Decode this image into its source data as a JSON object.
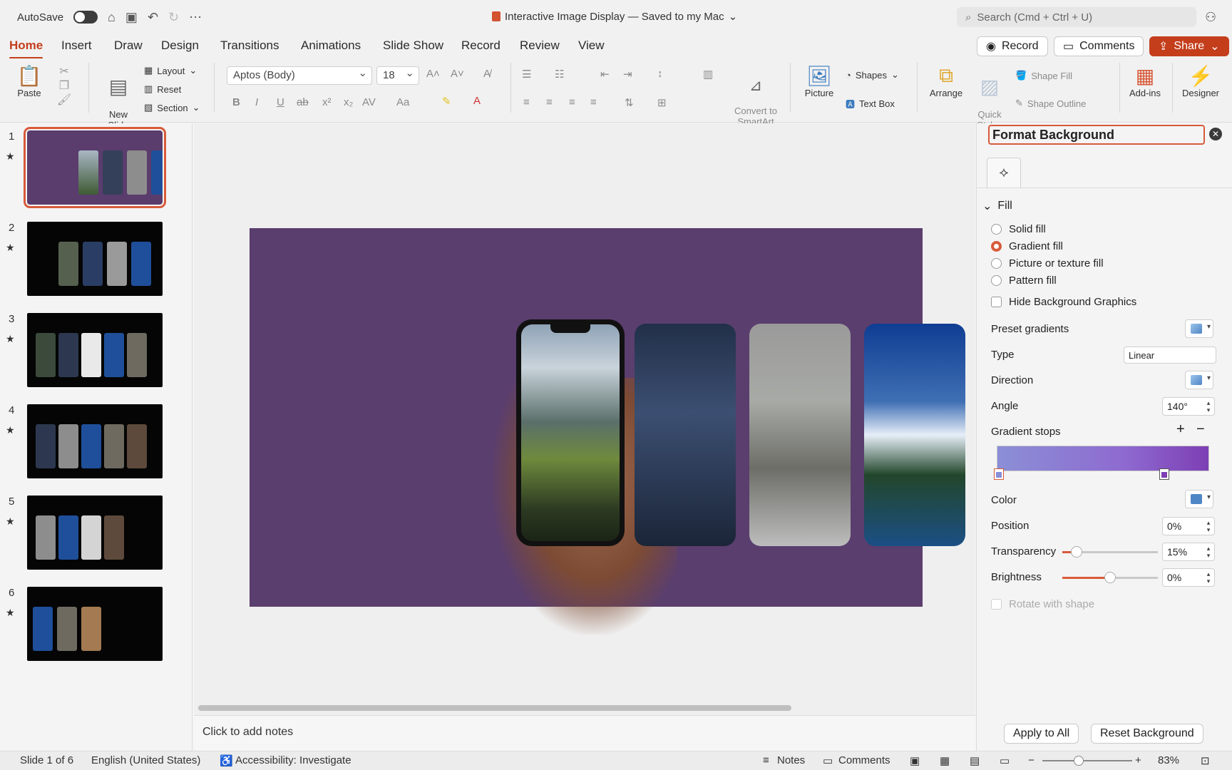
{
  "titlebar": {
    "autosave": "AutoSave",
    "doc_title": "Interactive Image Display — Saved to my Mac",
    "search_placeholder": "Search (Cmd + Ctrl + U)"
  },
  "tabs": [
    "Home",
    "Insert",
    "Draw",
    "Design",
    "Transitions",
    "Animations",
    "Slide Show",
    "Record",
    "Review",
    "View"
  ],
  "tab_buttons": {
    "record": "Record",
    "comments": "Comments",
    "share": "Share"
  },
  "ribbon": {
    "paste": "Paste",
    "new_slide": "New\nSlide",
    "layout": "Layout",
    "reset": "Reset",
    "section": "Section",
    "font": "Aptos (Body)",
    "size": "18",
    "convert": "Convert to\nSmartArt",
    "picture": "Picture",
    "shapes": "Shapes",
    "text_box": "Text Box",
    "arrange": "Arrange",
    "quick_styles": "Quick\nStyles",
    "shape_fill": "Shape Fill",
    "shape_outline": "Shape Outline",
    "addins": "Add-ins",
    "designer": "Designer"
  },
  "slides": [
    {
      "num": "1",
      "star": "★"
    },
    {
      "num": "2",
      "star": "★"
    },
    {
      "num": "3",
      "star": "★"
    },
    {
      "num": "4",
      "star": "★"
    },
    {
      "num": "5",
      "star": "★"
    },
    {
      "num": "6",
      "star": "★"
    }
  ],
  "notes_placeholder": "Click to add notes",
  "pane": {
    "title": "Format Background",
    "section": "Fill",
    "options": [
      "Solid fill",
      "Gradient fill",
      "Picture or texture fill",
      "Pattern fill"
    ],
    "selected_option": "Gradient fill",
    "hide_bg": "Hide Background Graphics",
    "preset_gradients": "Preset gradients",
    "type_label": "Type",
    "type_value": "Linear",
    "direction_label": "Direction",
    "angle_label": "Angle",
    "angle_value": "140°",
    "stops_label": "Gradient stops",
    "color_label": "Color",
    "position_label": "Position",
    "position_value": "0%",
    "transparency_label": "Transparency",
    "transparency_value": "15%",
    "brightness_label": "Brightness",
    "brightness_value": "0%",
    "rotate_label": "Rotate with shape",
    "apply_all": "Apply to All",
    "reset_bg": "Reset Background",
    "transparency_level": 0.15,
    "brightness_level": 0.5
  },
  "status": {
    "slide_info": "Slide 1 of 6",
    "language": "English (United States)",
    "accessibility": "Accessibility: Investigate",
    "notes": "Notes",
    "comments": "Comments",
    "zoom": "83%"
  },
  "colors": {
    "accent": "#c43e1c",
    "slide_bg": "#5a3e6e"
  }
}
